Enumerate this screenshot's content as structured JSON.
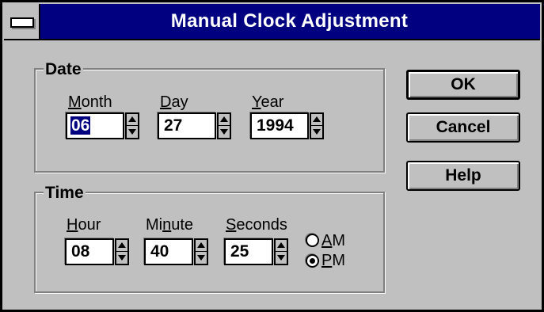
{
  "dialog": {
    "title": "Manual Clock Adjustment"
  },
  "date": {
    "group_label": "Date",
    "month": {
      "label_u": "M",
      "label_rest": "onth",
      "value": "06",
      "selected": true
    },
    "day": {
      "label_u": "D",
      "label_rest": "ay",
      "value": "27"
    },
    "year": {
      "label_u": "Y",
      "label_rest": "ear",
      "value": "1994"
    }
  },
  "time": {
    "group_label": "Time",
    "hour": {
      "label_u": "H",
      "label_rest": "our",
      "value": "08"
    },
    "minute": {
      "label_pre": "Mi",
      "label_u": "n",
      "label_rest": "ute",
      "value": "40"
    },
    "seconds": {
      "label_u": "S",
      "label_rest": "econds",
      "value": "25"
    },
    "am": {
      "label_u": "A",
      "label_rest": "M",
      "checked": false
    },
    "pm": {
      "label_u": "P",
      "label_rest": "M",
      "checked": true
    }
  },
  "buttons": {
    "ok": "OK",
    "cancel": "Cancel",
    "help": "Help"
  },
  "icons": {
    "system_menu": "system-menu-icon",
    "spin": "spin-arrows-icon",
    "radio": "radio-button-icon"
  },
  "colors": {
    "face": "#c0c0c0",
    "title_bar": "#000080",
    "selection": "#000080",
    "shadow": "#808080"
  }
}
